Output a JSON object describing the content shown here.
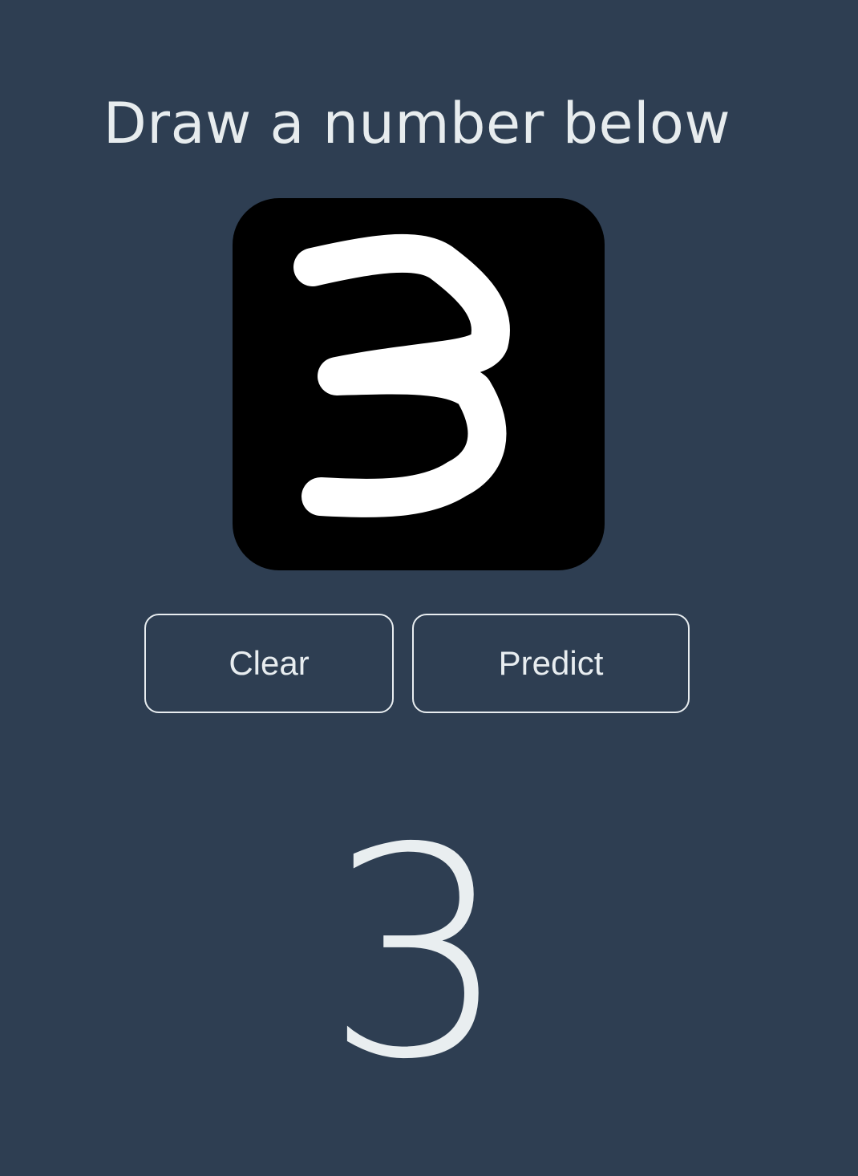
{
  "header": {
    "title": "Draw a number below"
  },
  "canvas": {
    "background_color": "#000000",
    "stroke_color": "#ffffff"
  },
  "controls": {
    "clear_label": "Clear",
    "predict_label": "Predict"
  },
  "prediction": {
    "value": "3"
  },
  "colors": {
    "page_background": "#2e3e52",
    "text": "#e9eef0"
  }
}
